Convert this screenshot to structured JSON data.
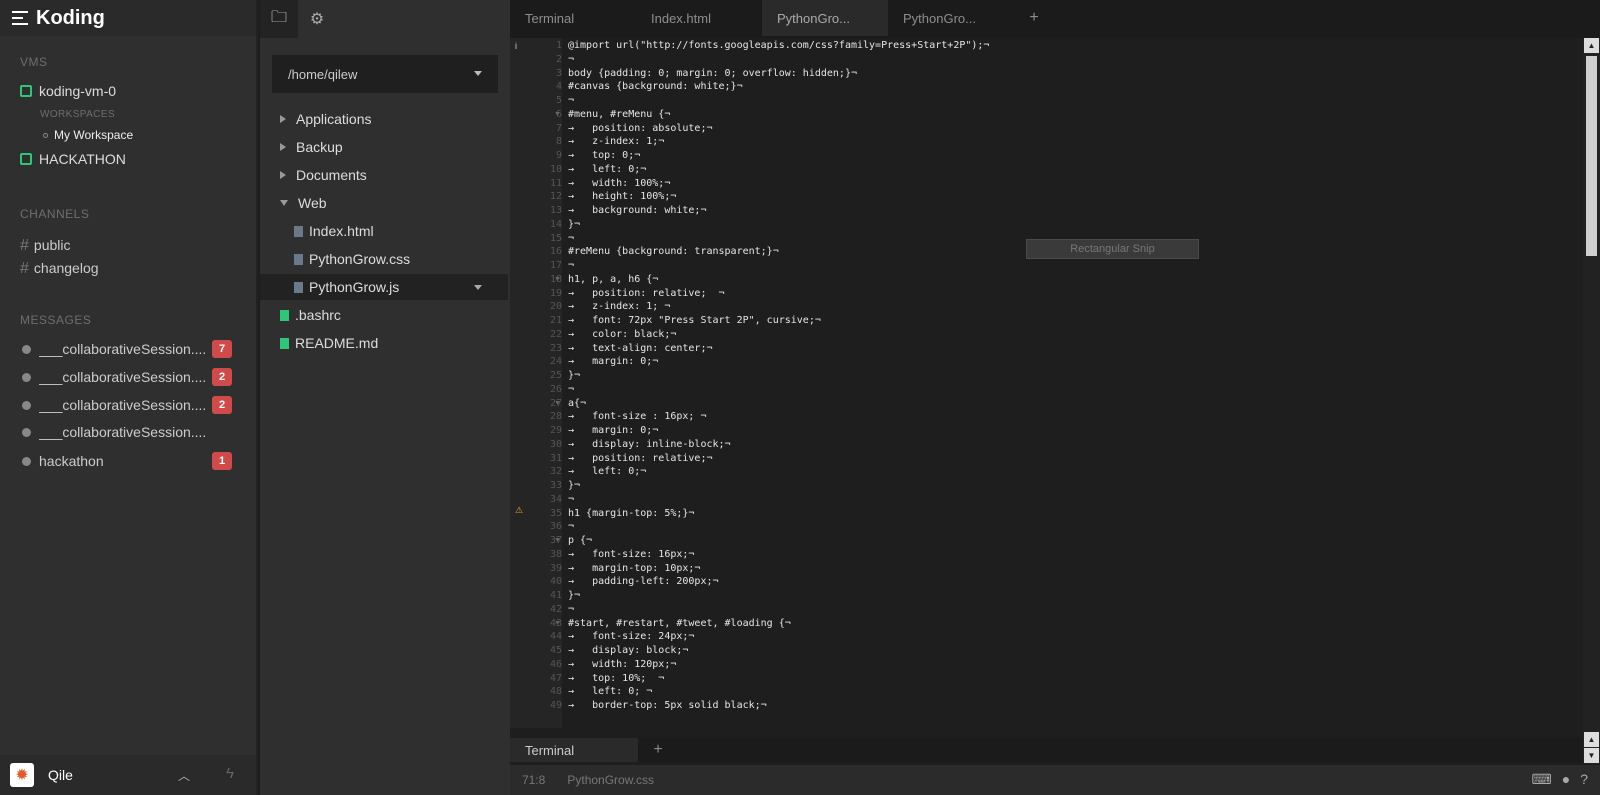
{
  "sidebar": {
    "brand": "Koding",
    "vms_heading": "VMS",
    "vm1": "koding-vm-0",
    "workspaces_heading": "WORKSPACES",
    "workspace": "My Workspace",
    "vm2": "HACKATHON",
    "channels_heading": "CHANNELS",
    "channels": [
      "public",
      "changelog"
    ],
    "messages_heading": "MESSAGES",
    "messages": [
      {
        "name": "___collaborativeSession....",
        "count": "7"
      },
      {
        "name": "___collaborativeSession....",
        "count": "2"
      },
      {
        "name": "___collaborativeSession....",
        "count": "2"
      },
      {
        "name": "___collaborativeSession....",
        "count": ""
      },
      {
        "name": "hackathon",
        "count": "1"
      }
    ],
    "user": "Qile"
  },
  "files": {
    "path": "/home/qilew",
    "items": [
      {
        "name": "Applications",
        "type": "folder"
      },
      {
        "name": "Backup",
        "type": "folder"
      },
      {
        "name": "Documents",
        "type": "folder"
      },
      {
        "name": "Web",
        "type": "folder-open"
      },
      {
        "name": "Index.html",
        "type": "file"
      },
      {
        "name": "PythonGrow.css",
        "type": "file"
      },
      {
        "name": "PythonGrow.js",
        "type": "file"
      },
      {
        "name": ".bashrc",
        "type": "file"
      },
      {
        "name": "README.md",
        "type": "file"
      }
    ]
  },
  "tabs": [
    "Terminal",
    "Index.html",
    "PythonGro...",
    "PythonGro..."
  ],
  "editor": {
    "lines": [
      "@import url(\"http://fonts.googleapis.com/css?family=Press+Start+2P\");¬",
      "¬",
      "body {padding: 0; margin: 0; overflow: hidden;}¬",
      "#canvas {background: white;}¬",
      "¬",
      "#menu, #reMenu {¬",
      "→   position: absolute;¬",
      "→   z-index: 1;¬",
      "→   top: 0;¬",
      "→   left: 0;¬",
      "→   width: 100%;¬",
      "→   height: 100%;¬",
      "→   background: white;¬",
      "}¬",
      "¬",
      "#reMenu {background: transparent;}¬",
      "¬",
      "h1, p, a, h6 {¬",
      "→   position: relative;  ¬",
      "→   z-index: 1; ¬",
      "→   font: 72px \"Press Start 2P\", cursive;¬",
      "→   color: black;¬",
      "→   text-align: center;¬",
      "→   margin: 0;¬",
      "}¬",
      "¬",
      "a{¬",
      "→   font-size : 16px; ¬",
      "→   margin: 0;¬",
      "→   display: inline-block;¬",
      "→   position: relative;¬",
      "→   left: 0;¬",
      "}¬",
      "¬",
      "h1 {margin-top: 5%;}¬",
      "¬",
      "p {¬",
      "→   font-size: 16px;¬",
      "→   margin-top: 10px;¬",
      "→   padding-left: 200px;¬",
      "}¬",
      "¬",
      "#start, #restart, #tweet, #loading {¬",
      "→   font-size: 24px;¬",
      "→   display: block;¬",
      "→   width: 120px;¬",
      "→   top: 10%;  ¬",
      "→   left: 0; ¬",
      "→   border-top: 5px solid black;¬"
    ],
    "snip": "Rectangular Snip"
  },
  "bottom_tab": "Terminal",
  "status": {
    "cursor": "71:8",
    "file": "PythonGrow.css"
  }
}
